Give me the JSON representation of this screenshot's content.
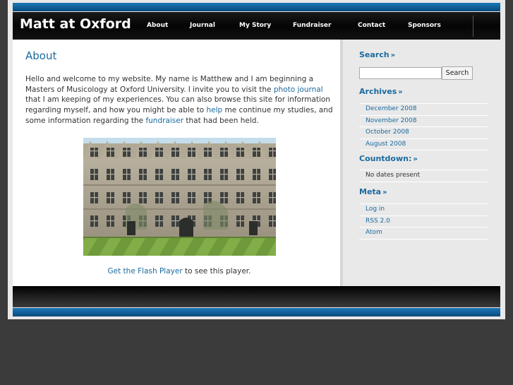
{
  "site": {
    "title": "Matt at Oxford"
  },
  "nav": {
    "items": [
      {
        "label": "About"
      },
      {
        "label": "Journal"
      },
      {
        "label": "My Story"
      },
      {
        "label": "Fundraiser"
      },
      {
        "label": "Contact"
      },
      {
        "label": "Sponsors"
      }
    ]
  },
  "main": {
    "title": "About",
    "intro": {
      "part1": "Hello and welcome to my website. My name is Matthew and I am beginning a Masters of Musicology at Oxford University. I invite you to visit the ",
      "link1": "photo journal",
      "part2": " that I am keeping of my experiences. You can also browse this site for information regarding myself, and how you might be able to ",
      "link2": "help",
      "part3": " me continue my studies, and some information regarding the ",
      "link3": "fundraiser",
      "part4": " that had been held."
    },
    "flash": {
      "link": "Get the Flash Player",
      "suffix": " to see this player."
    }
  },
  "sidebar": {
    "search": {
      "heading": "Search",
      "placeholder": "",
      "value": "",
      "button": "Search"
    },
    "archives": {
      "heading": "Archives",
      "items": [
        "December 2008",
        "November 2008",
        "October 2008",
        "August 2008"
      ]
    },
    "countdown": {
      "heading": "Countdown:",
      "items": [
        "No dates present"
      ]
    },
    "meta": {
      "heading": "Meta",
      "items": [
        "Log in",
        "RSS 2.0",
        "Atom"
      ]
    },
    "raquo": "»"
  },
  "colors": {
    "accent": "#1a6a9e",
    "bar_blue": "#0e5d96",
    "header_black": "#050505",
    "page_background": "#3b3b3b",
    "sidebar_background": "#e9e9e9"
  }
}
